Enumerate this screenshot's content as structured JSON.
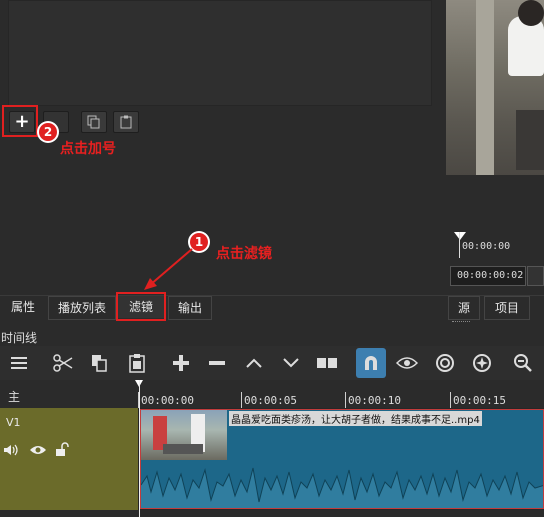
{
  "filters_panel": {
    "add_tooltip_annotation": "点击加号",
    "badge_two": "2"
  },
  "annotations": {
    "click_filters": "点击滤镜",
    "badge_one": "1"
  },
  "timecodes": {
    "position": "00:00:00",
    "duration": "00:00:00:02"
  },
  "tabs": [
    {
      "label": "属性"
    },
    {
      "label": "播放列表"
    },
    {
      "label": "滤镜"
    },
    {
      "label": "输出"
    }
  ],
  "right_tabs": [
    {
      "label": "源"
    },
    {
      "label": "项目"
    }
  ],
  "timeline": {
    "title": "时间线",
    "master_track": "主",
    "track_v1": "V1",
    "ruler": [
      "00:00:00",
      "00:00:05",
      "00:00:10",
      "00:00:15"
    ],
    "clip_name": "晶晶爱吃面类疹汤，让大胡子者做，结果成事不足..mp4"
  },
  "colors": {
    "accent": "#e02020",
    "track_header": "#6b6b2a",
    "clip_audio": "#1e6a8a",
    "snap_active": "#3d7fb0"
  }
}
